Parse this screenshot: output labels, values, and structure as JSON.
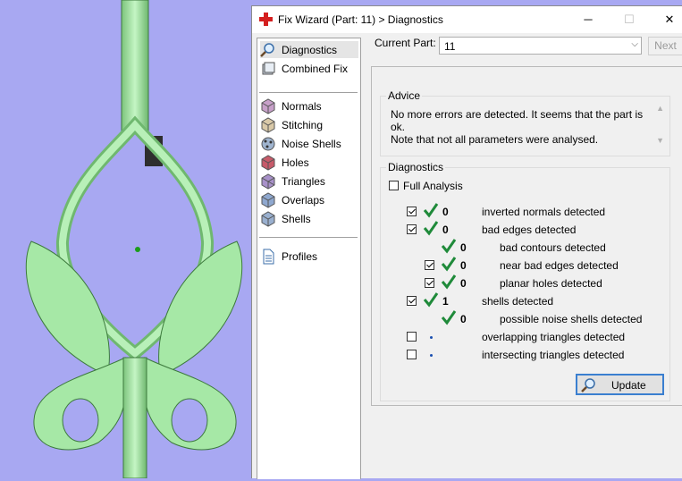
{
  "window": {
    "title": "Fix Wizard (Part: 11) > Diagnostics",
    "minimize_glyph": "─",
    "maximize_glyph": "☐",
    "close_glyph": "✕"
  },
  "nav": {
    "top": [
      {
        "label": "Diagnostics",
        "icon": "magnifier-icon",
        "selected": true
      },
      {
        "label": "Combined Fix",
        "icon": "combined-fix-icon"
      }
    ],
    "tools": [
      {
        "label": "Normals",
        "icon": "normals-icon"
      },
      {
        "label": "Stitching",
        "icon": "stitching-icon"
      },
      {
        "label": "Noise Shells",
        "icon": "noise-shells-icon"
      },
      {
        "label": "Holes",
        "icon": "holes-icon"
      },
      {
        "label": "Triangles",
        "icon": "triangles-icon"
      },
      {
        "label": "Overlaps",
        "icon": "overlaps-icon"
      },
      {
        "label": "Shells",
        "icon": "shells-icon"
      }
    ],
    "bottom": [
      {
        "label": "Profiles",
        "icon": "document-icon"
      }
    ]
  },
  "current_part": {
    "label": "Current Part:",
    "value": "11",
    "next_label": "Next"
  },
  "advice": {
    "title": "Advice",
    "text_line1": "No more errors are detected. It seems that the part is ok.",
    "text_line2": "Note that not all parameters were analysed."
  },
  "diagnostics": {
    "title": "Diagnostics",
    "full_analysis_label": "Full Analysis",
    "rows": [
      {
        "checked": true,
        "status": "check",
        "count": "0",
        "label": "inverted normals detected"
      },
      {
        "checked": true,
        "status": "check",
        "count": "0",
        "label": "bad edges detected"
      },
      {
        "checked": null,
        "status": "check",
        "count": "0",
        "label": "bad contours detected"
      },
      {
        "checked": true,
        "status": "check",
        "count": "0",
        "label": "near bad edges detected"
      },
      {
        "checked": true,
        "status": "check",
        "count": "0",
        "label": "planar holes detected"
      },
      {
        "checked": true,
        "status": "check",
        "count": "1",
        "label": "shells detected"
      },
      {
        "checked": null,
        "status": "check",
        "count": "0",
        "label": "possible noise shells detected"
      },
      {
        "checked": false,
        "status": "dot",
        "count": "",
        "label": "overlapping triangles detected"
      },
      {
        "checked": false,
        "status": "dot",
        "count": "",
        "label": "intersecting triangles detected"
      }
    ],
    "update_label": "Update"
  },
  "colors": {
    "viewport_bg": "#a8a8f2",
    "model_fill": "#a6e8a6",
    "check_green": "#1f8a3a"
  }
}
